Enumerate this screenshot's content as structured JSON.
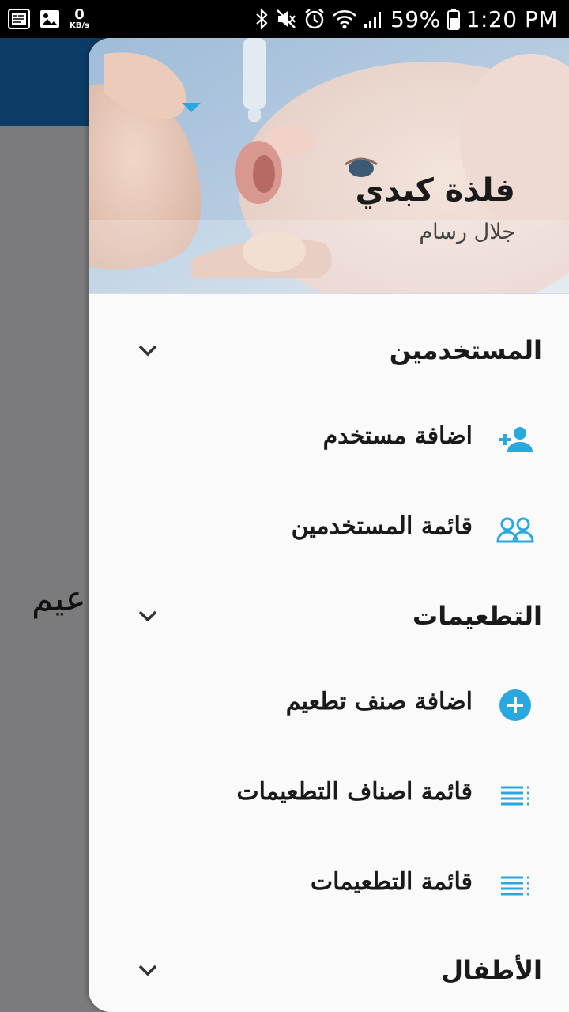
{
  "status_bar": {
    "net_speed_value": "0",
    "net_speed_unit": "KB/s",
    "battery_percent": "59%",
    "time": "1:20 PM"
  },
  "background_app": {
    "partial_text": "عيم"
  },
  "drawer": {
    "header": {
      "user_name": "فلذة كبدي",
      "user_subtitle": "جلال رسام"
    },
    "sections": [
      {
        "title": "المستخدمين",
        "items": [
          {
            "label": "اضافة مستخدم",
            "icon": "person-add-icon"
          },
          {
            "label": "قائمة المستخدمين",
            "icon": "people-icon"
          }
        ]
      },
      {
        "title": "التطعيمات",
        "items": [
          {
            "label": "اضافة صنف تطعيم",
            "icon": "add-circle-icon"
          },
          {
            "label": "قائمة اصناف التطعيمات",
            "icon": "list-icon"
          },
          {
            "label": "قائمة التطعيمات",
            "icon": "list-icon"
          }
        ]
      },
      {
        "title": "الأطفال",
        "items": []
      }
    ]
  },
  "colors": {
    "accent": "#29a8e0",
    "app_bar": "#0b3c66",
    "scrim": "#7b7b7d"
  }
}
